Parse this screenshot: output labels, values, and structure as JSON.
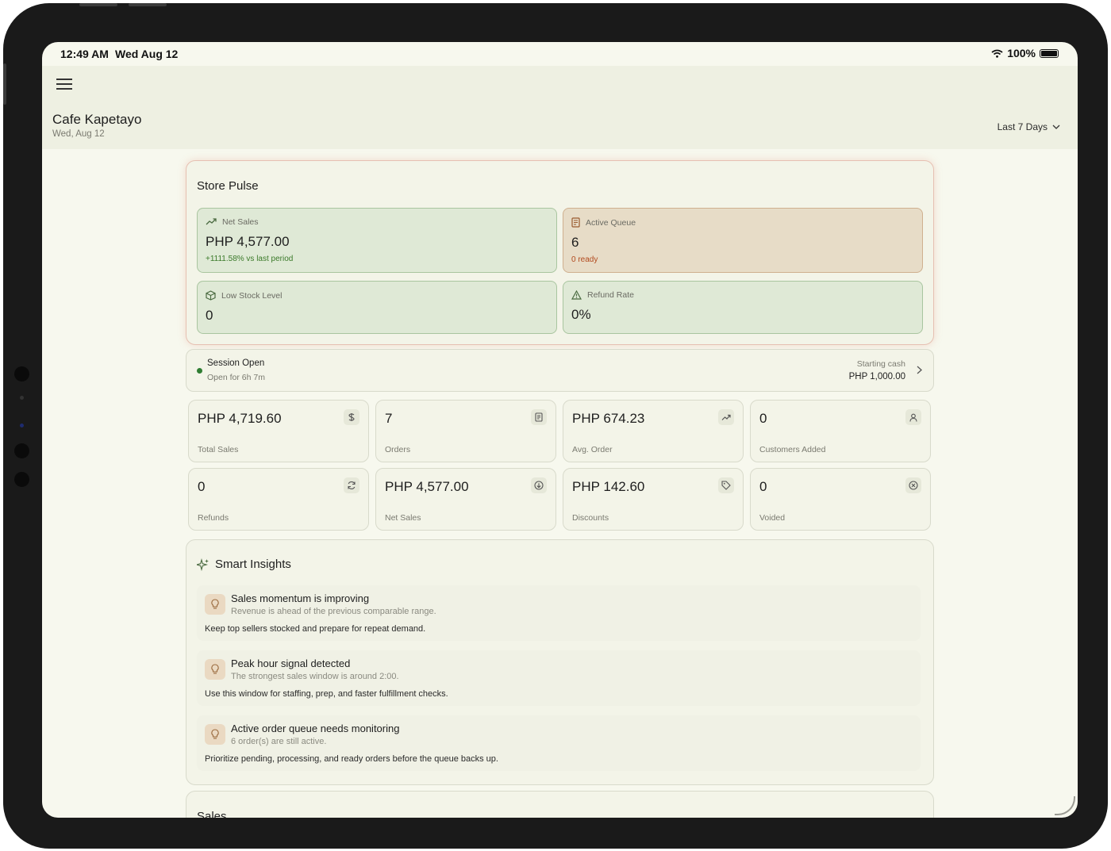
{
  "status_bar": {
    "time": "12:49 AM",
    "date": "Wed Aug 12",
    "battery": "100%"
  },
  "header": {
    "store_name": "Cafe Kapetayo",
    "date": "Wed, Aug 12",
    "range_label": "Last 7 Days"
  },
  "store_pulse": {
    "title": "Store Pulse",
    "tiles": [
      {
        "label": "Net Sales",
        "value": "PHP 4,577.00",
        "sub": "+1111.58% vs last period",
        "icon": "trending-up-icon"
      },
      {
        "label": "Active Queue",
        "value": "6",
        "sub": "0 ready",
        "icon": "receipt-icon"
      },
      {
        "label": "Low Stock Level",
        "value": "0",
        "icon": "box-icon"
      },
      {
        "label": "Refund Rate",
        "value": "0%",
        "icon": "alert-triangle-icon"
      }
    ]
  },
  "session": {
    "title": "Session Open",
    "duration": "Open for 6h 7m",
    "cash_label": "Starting cash",
    "cash_value": "PHP 1,000.00"
  },
  "stats": [
    {
      "value": "PHP 4,719.60",
      "label": "Total Sales",
      "icon": "dollar-icon"
    },
    {
      "value": "7",
      "label": "Orders",
      "icon": "receipt-icon"
    },
    {
      "value": "PHP 674.23",
      "label": "Avg. Order",
      "icon": "trending-up-icon"
    },
    {
      "value": "0",
      "label": "Customers Added",
      "icon": "user-icon"
    },
    {
      "value": "0",
      "label": "Refunds",
      "icon": "refresh-icon"
    },
    {
      "value": "PHP 4,577.00",
      "label": "Net Sales",
      "icon": "arrow-down-circle-icon"
    },
    {
      "value": "PHP 142.60",
      "label": "Discounts",
      "icon": "tag-icon"
    },
    {
      "value": "0",
      "label": "Voided",
      "icon": "x-circle-icon"
    }
  ],
  "insights": {
    "title": "Smart Insights",
    "items": [
      {
        "title": "Sales momentum is improving",
        "sub": "Revenue is ahead of the previous comparable range.",
        "body": "Keep top sellers stocked and prepare for repeat demand."
      },
      {
        "title": "Peak hour signal detected",
        "sub": "The strongest sales window is around 2:00.",
        "body": "Use this window for staffing, prep, and faster fulfillment checks."
      },
      {
        "title": "Active order queue needs monitoring",
        "sub": "6 order(s) are still active.",
        "body": "Prioritize pending, processing, and ready orders before the queue backs up."
      }
    ]
  },
  "sales": {
    "title": "Sales"
  },
  "colors": {
    "background": "#f7f8ee",
    "accent_green": "#3b7a2a",
    "accent_red": "#b24a1e",
    "tile_green": "#dfe9d6",
    "tile_tan": "#e7dcc7"
  }
}
